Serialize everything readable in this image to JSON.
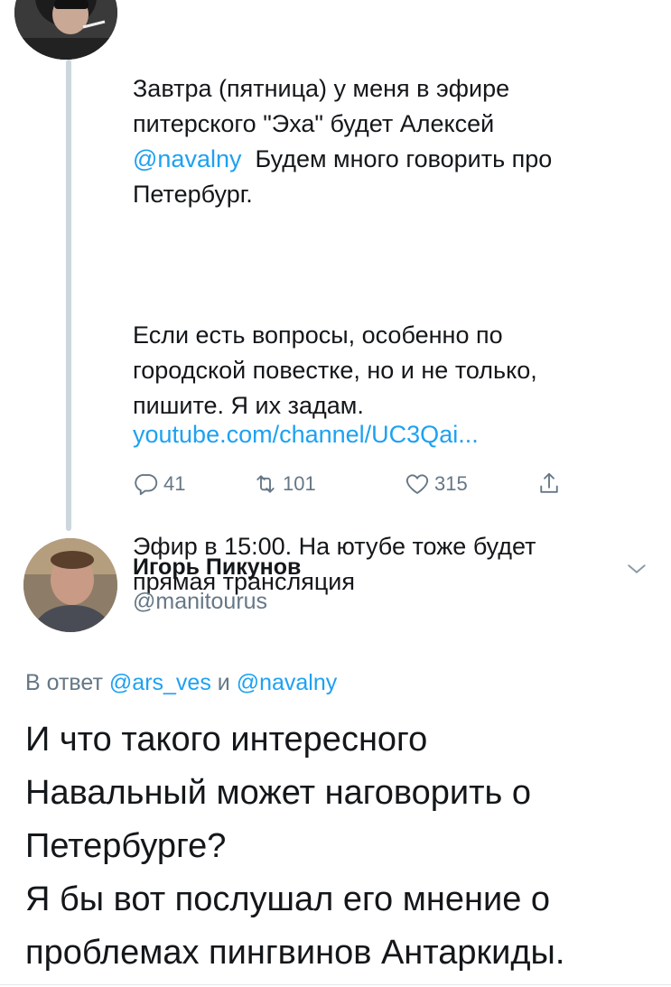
{
  "tweet1": {
    "para1": {
      "before": "Завтра (пятница) у меня в эфире\nпитерского \"Эха\" будет Алексей\n",
      "mention": "@navalny",
      "after": "  Будем много говорить про\nПетербург."
    },
    "para2": "Если есть вопросы, особенно по\nгородской повестке, но и не только,\nпишите. Я их задам.",
    "para3": "Эфир в 15:00. На ютубе тоже будет\nпрямая трансляция",
    "link": "youtube.com/channel/UC3Qai...",
    "actions": {
      "replies": "41",
      "retweets": "101",
      "likes": "315"
    }
  },
  "tweet2": {
    "name": "Игорь Пикунов",
    "handle": "@manitourus",
    "reply_prefix": "В ответ ",
    "reply_mention1": "@ars_ves",
    "reply_and": " и ",
    "reply_mention2": "@navalny",
    "text": "И что такого интересного\nНавальный может наговорить о\nПетербурге?\nЯ бы вот послушал его мнение о\nпроблемах пингвинов Антаркиды."
  },
  "icons": {
    "reply": "reply-icon",
    "retweet": "retweet-icon",
    "like": "heart-icon",
    "share": "share-icon",
    "menu": "chevron-down-icon"
  },
  "colors": {
    "accent": "#1da1f2",
    "muted": "#657786",
    "text": "#14171a",
    "thread_line": "#ccd6dd"
  }
}
